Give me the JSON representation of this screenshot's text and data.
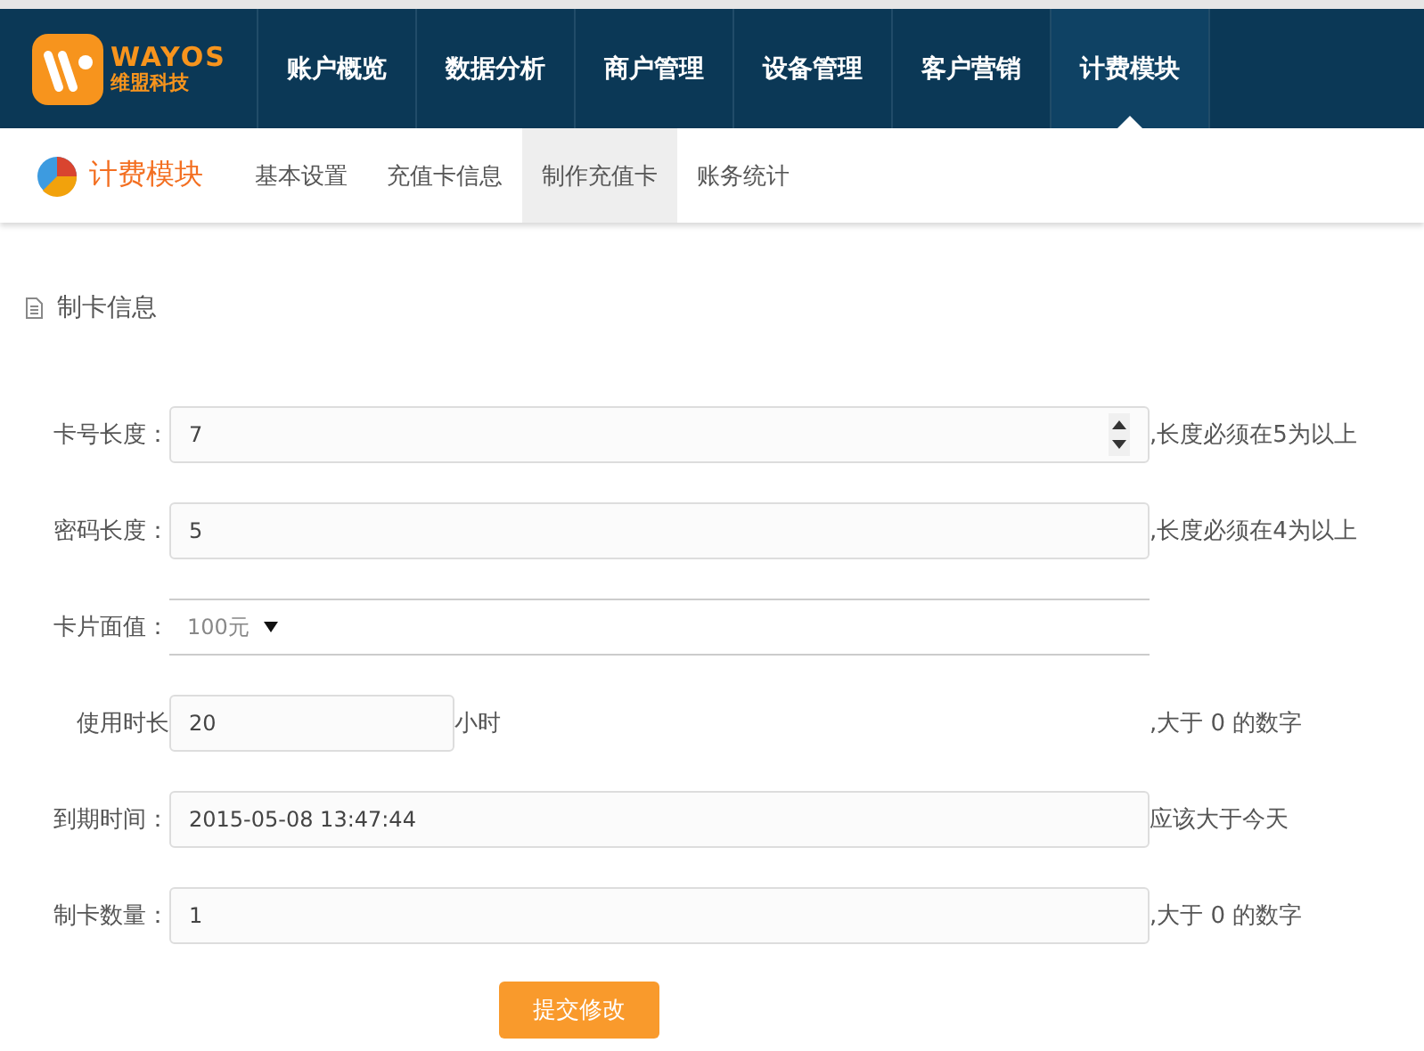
{
  "brand": {
    "name": "WAYOS",
    "subtitle": "维盟科技"
  },
  "nav": [
    {
      "label": "账户概览",
      "selected": false
    },
    {
      "label": "数据分析",
      "selected": false
    },
    {
      "label": "商户管理",
      "selected": false
    },
    {
      "label": "设备管理",
      "selected": false
    },
    {
      "label": "客户营销",
      "selected": false
    },
    {
      "label": "计费模块",
      "selected": true
    }
  ],
  "module_title": "计费模块",
  "subtabs": [
    {
      "label": "基本设置",
      "selected": false
    },
    {
      "label": "充值卡信息",
      "selected": false
    },
    {
      "label": "制作充值卡",
      "selected": true
    },
    {
      "label": "账务统计",
      "selected": false
    }
  ],
  "section_title": "制卡信息",
  "fields": [
    {
      "kind": "number",
      "label": "卡号长度：",
      "value": "7",
      "hint": ",长度必须在5为以上"
    },
    {
      "kind": "text",
      "label": "密码长度：",
      "value": "5",
      "hint": ",长度必须在4为以上"
    },
    {
      "kind": "select",
      "label": "卡片面值：",
      "value": "100元"
    },
    {
      "kind": "unit",
      "label": "使用时长",
      "value": "20",
      "unit": "小时",
      "hint": ",大于 0 的数字"
    },
    {
      "kind": "text",
      "label": "到期时间：",
      "value": "2015-05-08 13:47:44",
      "hint": "应该大于今天"
    },
    {
      "kind": "text",
      "label": "制卡数量：",
      "value": "1",
      "hint": ",大于 0 的数字"
    }
  ],
  "submit": "提交修改"
}
